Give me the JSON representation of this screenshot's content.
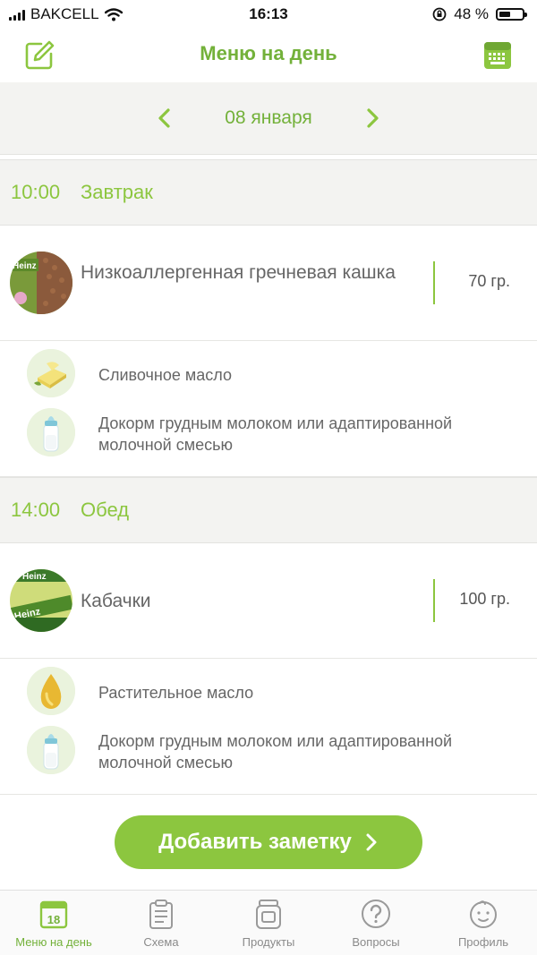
{
  "status_bar": {
    "carrier": "BAKCELL",
    "time": "16:13",
    "battery_percent": "48 %",
    "battery_level": 0.48
  },
  "header": {
    "title": "Меню на день",
    "left_icon": "edit-icon",
    "right_icon": "keyboard-calendar-icon"
  },
  "date_nav": {
    "date": "08 января"
  },
  "meals": [
    {
      "time": "10:00",
      "name": "Завтрак",
      "main": {
        "name": "Низкоаллергенная гречневая кашка",
        "quantity": "70 гр."
      },
      "extras": [
        {
          "text": "Сливочное масло",
          "icon": "butter-icon"
        },
        {
          "text": "Докорм грудным молоком или адаптированной молочной смесью",
          "icon": "baby-bottle-icon"
        }
      ]
    },
    {
      "time": "14:00",
      "name": "Обед",
      "main": {
        "name": "Кабачки",
        "quantity": "100 гр."
      },
      "extras": [
        {
          "text": "Растительное масло",
          "icon": "oil-drop-icon"
        },
        {
          "text": "Докорм грудным молоком или адаптированной молочной смесью",
          "icon": "baby-bottle-icon"
        }
      ]
    }
  ],
  "add_note_button": {
    "label": "Добавить заметку"
  },
  "tabbar": {
    "tabs": [
      {
        "label": "Меню на день",
        "icon": "calendar-18-icon",
        "active": true
      },
      {
        "label": "Схема",
        "icon": "clipboard-icon"
      },
      {
        "label": "Продукты",
        "icon": "jar-icon"
      },
      {
        "label": "Вопросы",
        "icon": "question-icon"
      },
      {
        "label": "Профиль",
        "icon": "baby-face-icon"
      }
    ]
  },
  "colors": {
    "accent": "#8cc63f",
    "accent_dark": "#73b13a",
    "band_bg": "#f3f3f1",
    "text": "#666666"
  }
}
